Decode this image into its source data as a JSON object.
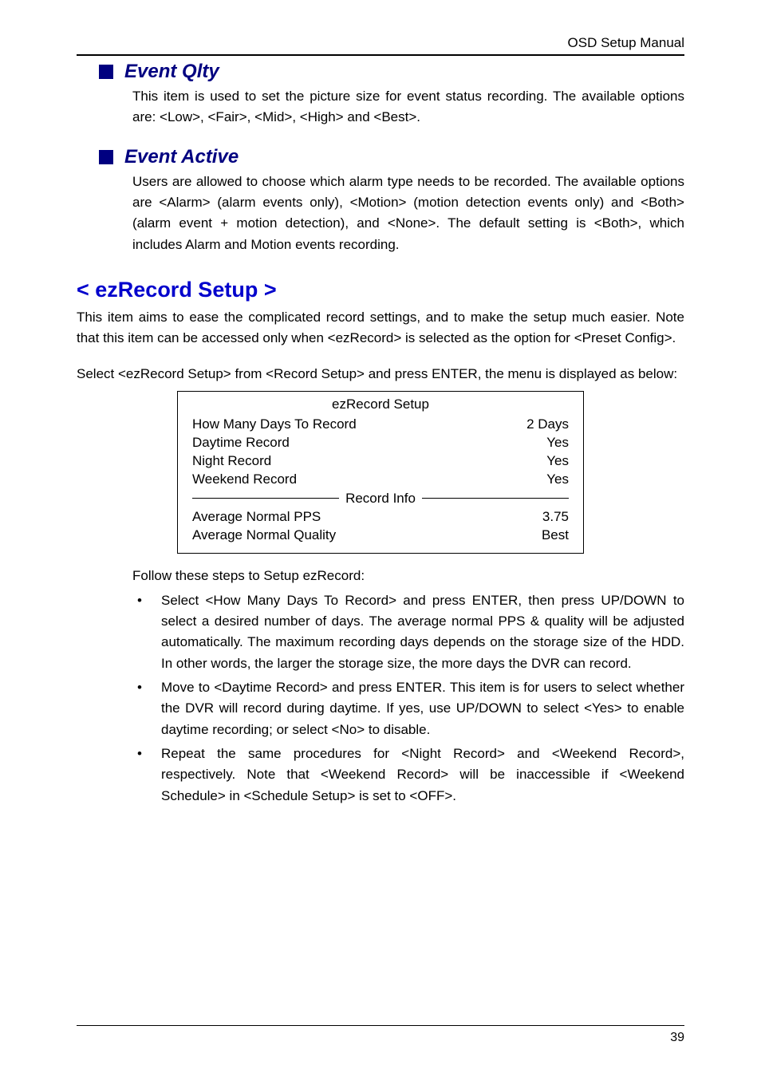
{
  "header": {
    "title": "OSD Setup Manual"
  },
  "section_event_qlty": {
    "title": "Event Qlty",
    "body": "This item is used to set the picture size for event status recording. The available options are: <Low>, <Fair>, <Mid>, <High> and <Best>."
  },
  "section_event_active": {
    "title": "Event Active",
    "body": "Users are allowed to choose which alarm type needs to be recorded. The available options are <Alarm> (alarm events only), <Motion> (motion detection events only) and <Both> (alarm event + motion detection), and <None>. The default setting is <Both>, which includes Alarm and Motion events recording."
  },
  "ezrecord": {
    "heading": "< ezRecord Setup >",
    "intro1": "This item aims to ease the complicated record settings, and to make the setup much easier. Note that this item can be accessed only when <ezRecord> is selected as the option for <Preset Config>.",
    "intro2": "Select <ezRecord Setup> from <Record Setup> and press ENTER, the menu is displayed as below:",
    "box": {
      "title": "ezRecord Setup",
      "rows": [
        {
          "label": "How Many Days To Record",
          "value": "2 Days"
        },
        {
          "label": "Daytime Record",
          "value": "Yes"
        },
        {
          "label": "Night Record",
          "value": "Yes"
        },
        {
          "label": "Weekend Record",
          "value": "Yes"
        }
      ],
      "separator": "Record Info",
      "rows2": [
        {
          "label": "Average Normal PPS",
          "value": "3.75"
        },
        {
          "label": "Average Normal Quality",
          "value": "Best"
        }
      ]
    },
    "follow_label": "Follow these steps to Setup ezRecord:",
    "bullets": [
      "Select <How Many Days To Record> and press ENTER, then press UP/DOWN to select a desired number of days. The average normal PPS & quality will be adjusted automatically. The maximum recording days depends on the storage size of the HDD. In other words, the larger the storage size, the more days the DVR can record.",
      "Move to <Daytime Record> and press ENTER. This item is for users to select whether the DVR will record during daytime. If yes, use UP/DOWN to select <Yes> to enable daytime recording; or select <No> to disable.",
      "Repeat the same procedures for <Night Record> and <Weekend Record>, respectively. Note that <Weekend Record> will be inaccessible if <Weekend Schedule> in <Schedule Setup> is set to <OFF>."
    ]
  },
  "footer": {
    "page": "39"
  }
}
